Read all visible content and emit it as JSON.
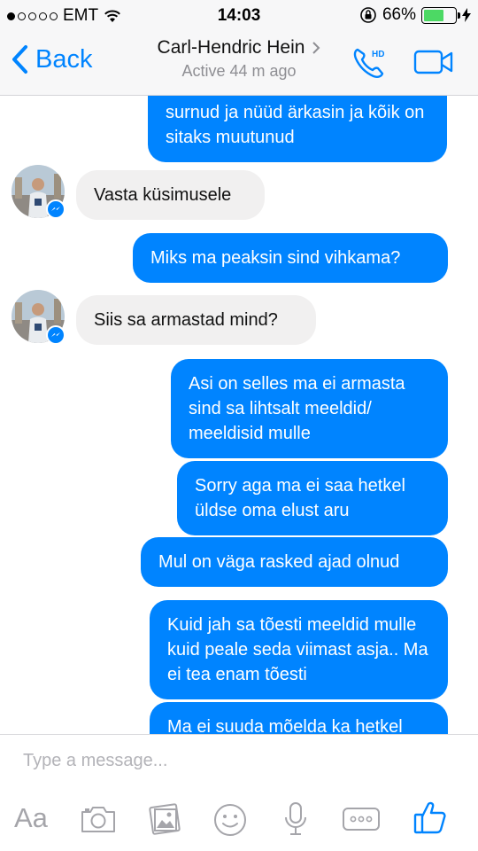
{
  "status": {
    "carrier": "EMT",
    "time": "14:03",
    "battery": "66%",
    "battery_level": 0.66
  },
  "header": {
    "back_label": "Back",
    "contact_name": "Carl-Hendric Hein",
    "active_status": "Active 44 m ago",
    "call_icon_text": "HD"
  },
  "messages": [
    {
      "dir": "out",
      "text": "surnud ja nüüd ärkasin ja kõik on sitaks muutunud"
    },
    {
      "dir": "in",
      "text": "Vasta küsimusele"
    },
    {
      "dir": "out",
      "text": "Miks ma peaksin sind vihkama?"
    },
    {
      "dir": "in",
      "text": "Siis sa armastad mind?"
    },
    {
      "dir": "out",
      "text": "Asi on selles ma ei armasta sind sa lihtsalt meeldid/ meeldisid mulle"
    },
    {
      "dir": "out",
      "text": "Sorry aga ma ei saa hetkel üldse oma elust aru"
    },
    {
      "dir": "out",
      "text": "Mul on väga rasked ajad olnud"
    },
    {
      "dir": "out",
      "text": "Kuid jah sa tõesti meeldid mulle kuid peale seda viimast asja.. Ma ei tea enam tõesti"
    },
    {
      "dir": "out",
      "text": "Ma ei suuda mõelda ka hetkel"
    }
  ],
  "composer": {
    "placeholder": "Type a message...",
    "text_format_label": "Aa"
  },
  "colors": {
    "accent": "#0084ff",
    "incoming_bubble": "#f1f0f0",
    "battery": "#4cd964"
  }
}
